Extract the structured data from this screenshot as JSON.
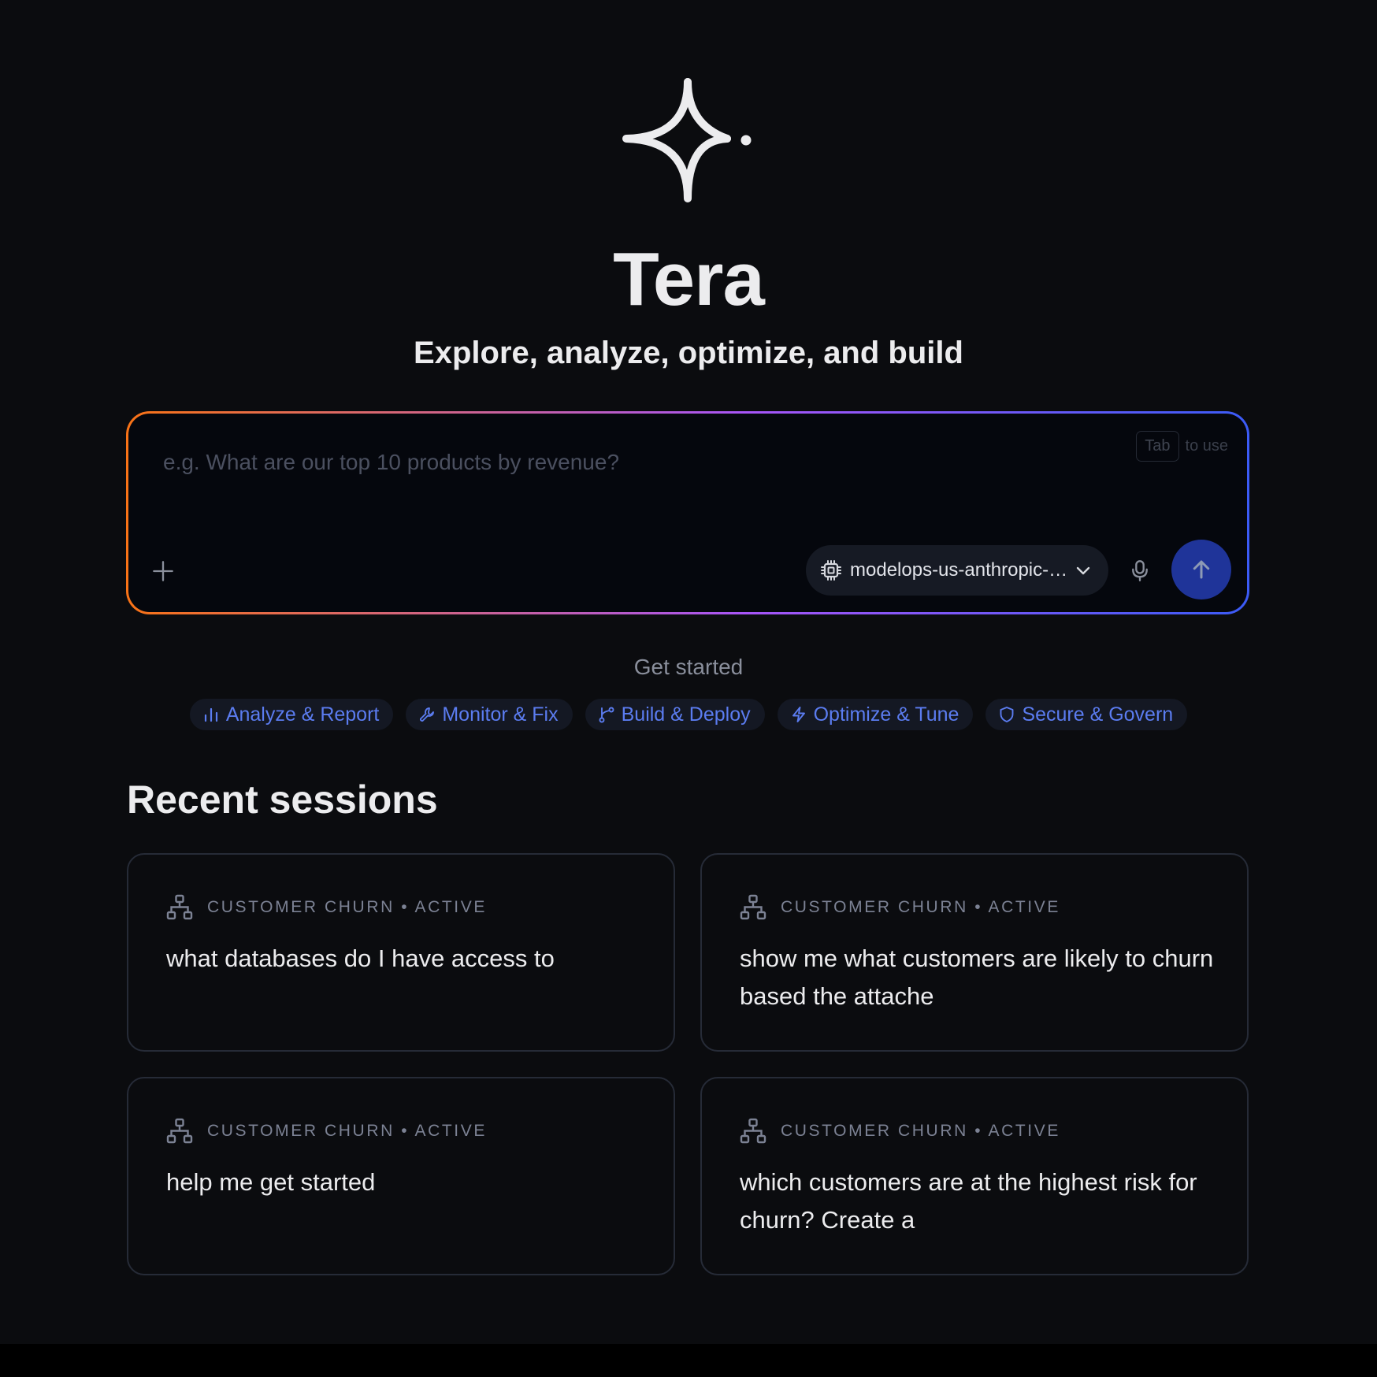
{
  "app": {
    "title": "Tera",
    "subtitle": "Explore, analyze, optimize, and build",
    "logo_icon": "sparkle-icon"
  },
  "prompt": {
    "placeholder": "e.g. What are our top 10 products by revenue?",
    "value": "",
    "tab_key": "Tab",
    "tab_hint": "to use",
    "model_label": "modelops-us-anthropic-…",
    "icons": [
      "plus-icon",
      "chip-icon",
      "chevron-down-icon",
      "mic-icon",
      "arrow-up-icon"
    ],
    "send_color": "#1f3499",
    "border_gradient": [
      "#f97316",
      "#a855f7",
      "#3b5bf6"
    ]
  },
  "get_started": {
    "label": "Get started",
    "chips": [
      {
        "label": "Analyze & Report",
        "icon": "bar-chart-icon"
      },
      {
        "label": "Monitor & Fix",
        "icon": "wrench-icon"
      },
      {
        "label": "Build & Deploy",
        "icon": "git-branch-icon"
      },
      {
        "label": "Optimize & Tune",
        "icon": "lightning-icon"
      },
      {
        "label": "Secure & Govern",
        "icon": "shield-icon"
      }
    ],
    "chip_color": "#5b7cf0"
  },
  "recent": {
    "title": "Recent sessions",
    "sessions": [
      {
        "meta": "CUSTOMER CHURN • ACTIVE",
        "text": "what databases do I have access to",
        "icon": "network-icon"
      },
      {
        "meta": "CUSTOMER CHURN • ACTIVE",
        "text": "show me what customers are likely to churn based the attache",
        "icon": "network-icon"
      },
      {
        "meta": "CUSTOMER CHURN • ACTIVE",
        "text": "help me get started",
        "icon": "network-icon"
      },
      {
        "meta": "CUSTOMER CHURN • ACTIVE",
        "text": "which customers are at the highest risk for churn? Create a",
        "icon": "network-icon"
      }
    ]
  }
}
